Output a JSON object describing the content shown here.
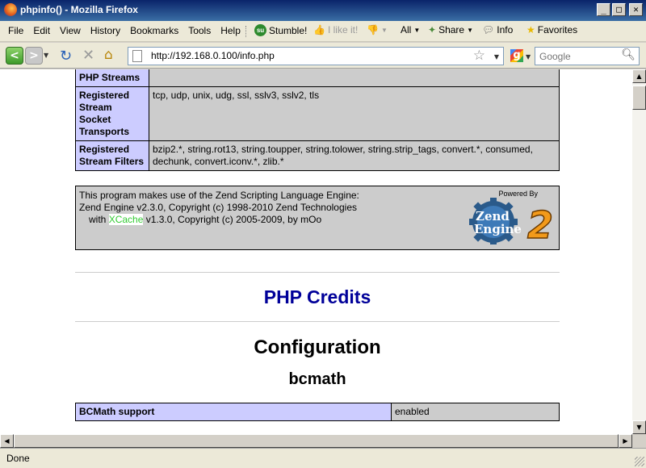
{
  "window": {
    "title": "phpinfo() - Mozilla Firefox"
  },
  "menubar": {
    "menus": [
      "File",
      "Edit",
      "View",
      "History",
      "Bookmarks",
      "Tools",
      "Help"
    ],
    "stumble_label": "Stumble!",
    "like_label": "I like it!",
    "all_label": "All",
    "share_label": "Share",
    "info_label": "Info",
    "favorites_label": "Favorites"
  },
  "navbar": {
    "url": "http://192.168.0.100/info.php",
    "search_placeholder": "Google"
  },
  "page": {
    "stream_rows": [
      {
        "label": "PHP Streams",
        "value": ""
      },
      {
        "label": "Registered Stream Socket Transports",
        "value": "tcp, udp, unix, udg, ssl, sslv3, sslv2, tls"
      },
      {
        "label": "Registered Stream Filters",
        "value": "bzip2.*, string.rot13, string.toupper, string.tolower, string.strip_tags, convert.*, consumed, dechunk, convert.iconv.*, zlib.*"
      }
    ],
    "zend": {
      "line1": "This program makes use of the Zend Scripting Language Engine:",
      "line2": "Zend Engine v2.3.0, Copyright (c) 1998-2010 Zend Technologies",
      "line3_prefix": "with",
      "xcache_link": "XCache",
      "line3_suffix": "v1.3.0, Copyright (c) 2005-2009, by mOo",
      "powered_by": "Powered By",
      "logo_text1": "Zend",
      "logo_text2": "Engine",
      "logo_num": "2"
    },
    "credits_title": "PHP Credits",
    "configuration_title": "Configuration",
    "module_title": "bcmath",
    "module_rows": [
      {
        "label": "BCMath support",
        "value": "enabled"
      }
    ]
  },
  "statusbar": {
    "text": "Done"
  }
}
